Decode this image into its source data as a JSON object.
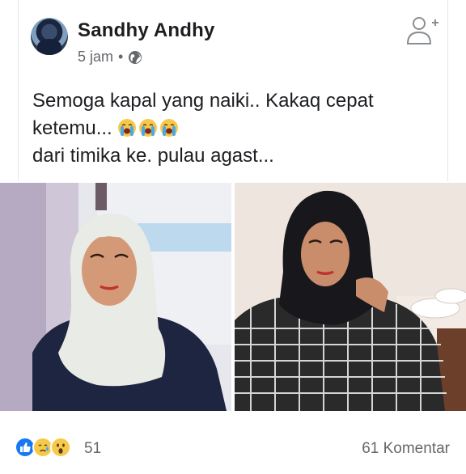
{
  "post": {
    "author": "Sandhy Andhy",
    "time": "5 jam",
    "separator": "•",
    "text_line1": "Semoga kapal yang naiki.. Kakaq cepat",
    "text_line2": "ketemu...",
    "text_line3": "dari timika ke. pulau agast..."
  },
  "icons": {
    "privacy": "globe-icon",
    "add_friend": "add-friend-icon",
    "emoji": "crying-face-emoji",
    "reactions": [
      "like-reaction-icon",
      "care-reaction-icon",
      "wow-reaction-icon"
    ]
  },
  "engagement": {
    "reaction_count": "51",
    "comments": "61 Komentar"
  },
  "colors": {
    "text": "#1c1e21",
    "secondary": "#65676b",
    "like_blue": "#1877f2",
    "emoji_yellow": "#f7c94b"
  }
}
